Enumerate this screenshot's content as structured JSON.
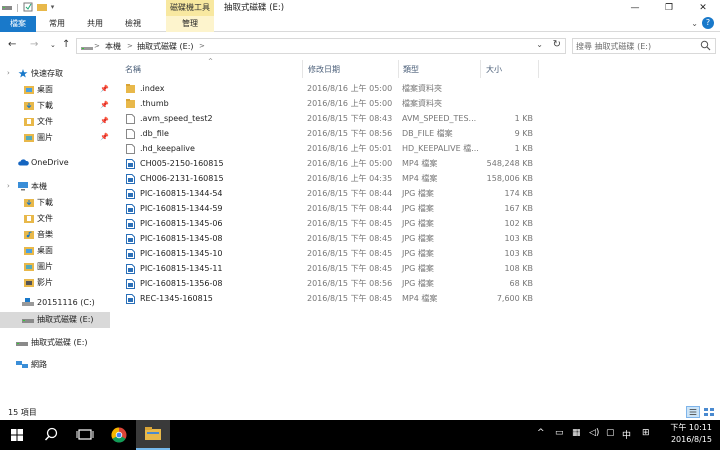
{
  "window": {
    "context_tab": "磁碟機工具",
    "title": "抽取式磁碟 (E:)"
  },
  "ribbon": {
    "tabs": [
      {
        "label": "檔案"
      },
      {
        "label": "常用"
      },
      {
        "label": "共用"
      },
      {
        "label": "檢視"
      },
      {
        "label": "管理"
      }
    ]
  },
  "address": {
    "crumbs": [
      "本機",
      "抽取式磁碟 (E:)"
    ],
    "separator": ">",
    "search_placeholder": "搜尋 抽取式磁碟 (E:)"
  },
  "sidebar": {
    "quick_access": "快速存取",
    "quick_items": [
      "桌面",
      "下載",
      "文件",
      "圖片"
    ],
    "onedrive": "OneDrive",
    "this_pc": "本機",
    "pc_items": [
      "下載",
      "文件",
      "音樂",
      "桌面",
      "圖片",
      "影片"
    ],
    "drive_c": "20151116 (C:)",
    "drive_e": "抽取式磁碟 (E:)",
    "drive_e2": "抽取式磁碟 (E:)",
    "network": "網路"
  },
  "columns": {
    "name": "名稱",
    "date": "修改日期",
    "type": "類型",
    "size": "大小"
  },
  "files": [
    {
      "name": ".index",
      "date": "2016/8/16 上午 05:00",
      "type": "檔案資料夾",
      "size": "",
      "icon": "folder-icon"
    },
    {
      "name": ".thumb",
      "date": "2016/8/16 上午 05:00",
      "type": "檔案資料夾",
      "size": "",
      "icon": "folder-icon"
    },
    {
      "name": ".avm_speed_test2",
      "date": "2016/8/15 下午 08:43",
      "type": "AVM_SPEED_TES...",
      "size": "1 KB",
      "icon": "file-icon"
    },
    {
      "name": ".db_file",
      "date": "2016/8/15 下午 08:56",
      "type": "DB_FILE 檔案",
      "size": "9 KB",
      "icon": "file-icon"
    },
    {
      "name": ".hd_keepalive",
      "date": "2016/8/16 上午 05:01",
      "type": "HD_KEEPALIVE 檔...",
      "size": "1 KB",
      "icon": "file-icon"
    },
    {
      "name": "CH005-2150-160815",
      "date": "2016/8/16 上午 05:00",
      "type": "MP4 檔案",
      "size": "548,248 KB",
      "icon": "media-icon"
    },
    {
      "name": "CH006-2131-160815",
      "date": "2016/8/16 上午 04:35",
      "type": "MP4 檔案",
      "size": "158,006 KB",
      "icon": "media-icon"
    },
    {
      "name": "PIC-160815-1344-54",
      "date": "2016/8/15 下午 08:44",
      "type": "JPG 檔案",
      "size": "174 KB",
      "icon": "media-icon"
    },
    {
      "name": "PIC-160815-1344-59",
      "date": "2016/8/15 下午 08:44",
      "type": "JPG 檔案",
      "size": "167 KB",
      "icon": "media-icon"
    },
    {
      "name": "PIC-160815-1345-06",
      "date": "2016/8/15 下午 08:45",
      "type": "JPG 檔案",
      "size": "102 KB",
      "icon": "media-icon"
    },
    {
      "name": "PIC-160815-1345-08",
      "date": "2016/8/15 下午 08:45",
      "type": "JPG 檔案",
      "size": "103 KB",
      "icon": "media-icon"
    },
    {
      "name": "PIC-160815-1345-10",
      "date": "2016/8/15 下午 08:45",
      "type": "JPG 檔案",
      "size": "103 KB",
      "icon": "media-icon"
    },
    {
      "name": "PIC-160815-1345-11",
      "date": "2016/8/15 下午 08:45",
      "type": "JPG 檔案",
      "size": "108 KB",
      "icon": "media-icon"
    },
    {
      "name": "PIC-160815-1356-08",
      "date": "2016/8/15 下午 08:56",
      "type": "JPG 檔案",
      "size": "68 KB",
      "icon": "media-icon"
    },
    {
      "name": "REC-1345-160815",
      "date": "2016/8/15 下午 08:45",
      "type": "MP4 檔案",
      "size": "7,600 KB",
      "icon": "media-icon"
    }
  ],
  "status": {
    "item_count": "15 項目"
  },
  "taskbar": {
    "ime": "中",
    "time": "下午 10:11",
    "date": "2016/8/15"
  },
  "colors": {
    "accent": "#1979ca",
    "folder": "#e8b84a",
    "context_tab": "#f8e8a0",
    "selection": "#d9d9d9"
  }
}
